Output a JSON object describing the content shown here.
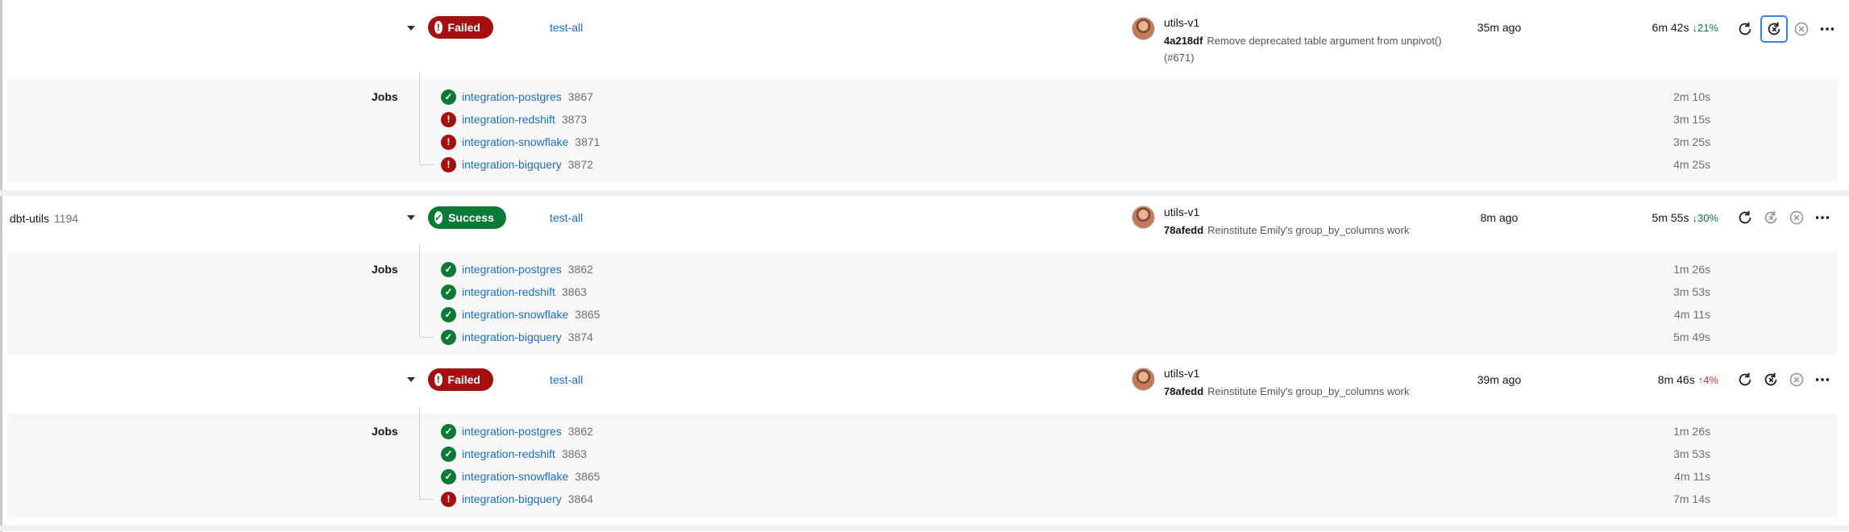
{
  "pipelines": [
    {
      "project": "",
      "project_num": "",
      "status": "Failed",
      "workflow": "test-all",
      "branch": "utils-v1",
      "sha": "4a218df",
      "message": "Remove deprecated table argument from unpivot() (#671)",
      "ago": "35m ago",
      "duration": "6m 42s",
      "delta": "21%",
      "delta_dir": "down",
      "jobs_label": "Jobs",
      "jobs": [
        {
          "name": "integration-postgres",
          "num": "3867",
          "status": "success",
          "duration": "2m 10s"
        },
        {
          "name": "integration-redshift",
          "num": "3873",
          "status": "failed",
          "duration": "3m 15s"
        },
        {
          "name": "integration-snowflake",
          "num": "3871",
          "status": "failed",
          "duration": "3m 25s"
        },
        {
          "name": "integration-bigquery",
          "num": "3872",
          "status": "failed",
          "duration": "4m 25s"
        }
      ]
    },
    {
      "project": "dbt-utils",
      "project_num": "1194",
      "status": "Success",
      "workflow": "test-all",
      "branch": "utils-v1",
      "sha": "78afedd",
      "message": "Reinstitute Emily's group_by_columns work",
      "ago": "8m ago",
      "duration": "5m 55s",
      "delta": "30%",
      "delta_dir": "down",
      "jobs_label": "Jobs",
      "jobs": [
        {
          "name": "integration-postgres",
          "num": "3862",
          "status": "success",
          "duration": "1m 26s"
        },
        {
          "name": "integration-redshift",
          "num": "3863",
          "status": "success",
          "duration": "3m 53s"
        },
        {
          "name": "integration-snowflake",
          "num": "3865",
          "status": "success",
          "duration": "4m 11s"
        },
        {
          "name": "integration-bigquery",
          "num": "3874",
          "status": "success",
          "duration": "5m 49s"
        }
      ]
    },
    {
      "project": "",
      "project_num": "",
      "status": "Failed",
      "workflow": "test-all",
      "branch": "utils-v1",
      "sha": "78afedd",
      "message": "Reinstitute Emily's group_by_columns work",
      "ago": "39m ago",
      "duration": "8m 46s",
      "delta": "4%",
      "delta_dir": "up",
      "jobs_label": "Jobs",
      "jobs": [
        {
          "name": "integration-postgres",
          "num": "3862",
          "status": "success",
          "duration": "1m 26s"
        },
        {
          "name": "integration-redshift",
          "num": "3863",
          "status": "success",
          "duration": "3m 53s"
        },
        {
          "name": "integration-snowflake",
          "num": "3865",
          "status": "success",
          "duration": "4m 11s"
        },
        {
          "name": "integration-bigquery",
          "num": "3864",
          "status": "failed",
          "duration": "7m 14s"
        }
      ]
    }
  ],
  "icons": {
    "rerun": "rerun-icon",
    "rerun_failed": "rerun-failed-icon",
    "cancel": "cancel-icon",
    "more": "more-icon",
    "status_success": "check-icon",
    "status_failed": "exclamation-icon"
  },
  "colors": {
    "failed": "#a50f0f",
    "success": "#0b7a36",
    "link": "#1a6fc4"
  }
}
